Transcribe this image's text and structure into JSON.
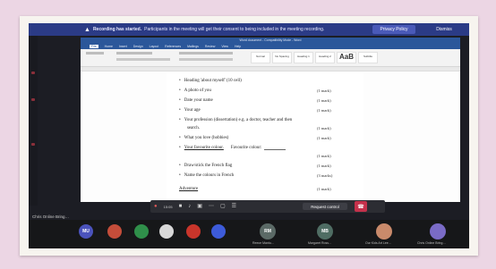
{
  "banner": {
    "bold": "Recording has started.",
    "message": "Participants in the meeting will get their consent to being included in the meeting recording.",
    "privacy_button": "Privacy Policy",
    "dismiss_button": "Dismiss"
  },
  "word": {
    "title": "Word document - Compatibility Mode - Word",
    "tabs": [
      "File",
      "Home",
      "Insert",
      "Design",
      "Layout",
      "References",
      "Mailings",
      "Review",
      "View",
      "Help"
    ],
    "styles": [
      "Normal",
      "No Spacing",
      "Heading 1",
      "Heading 2",
      "Title",
      "Subtitle"
    ],
    "title_style_sample": "AaB"
  },
  "document": {
    "items": [
      {
        "text": "Heading 'about myself' (10 cell)",
        "mark": ""
      },
      {
        "text": "A photo of you",
        "mark": "(1 mark)"
      },
      {
        "text": "Date your name",
        "mark": "(1 mark)"
      },
      {
        "text": "Your age",
        "mark": "(1 mark)"
      },
      {
        "text": "Your profession (dissertation) e.g. a doctor, teacher and then",
        "mark": ""
      },
      {
        "text": "search.",
        "mark": "(1 mark)"
      },
      {
        "text": "What you love (hobbies)",
        "mark": "(1 mark)"
      },
      {
        "text": "Your favourite colour.",
        "extra": "Favourite colour:",
        "mark": ""
      },
      {
        "text": "",
        "mark": "(1 mark)"
      },
      {
        "text": "Draw/stick the French flag",
        "mark": "(1 mark)"
      },
      {
        "text": "Name the colours in French",
        "mark": "(3 marks)"
      }
    ],
    "footer_word": "Adventure",
    "footer_mark": "(1 mark)"
  },
  "controls": {
    "timer": "15:05",
    "request_control": "Request control"
  },
  "presenter": "Chris Online Bring…",
  "participants": [
    {
      "initials": "MU",
      "label": "",
      "color": "#4b53bc"
    },
    {
      "initials": "",
      "label": "",
      "color": "#c44d3a"
    },
    {
      "initials": "",
      "label": "",
      "color": "#2f8f4a"
    },
    {
      "initials": "",
      "label": "",
      "color": "#d8d8d8"
    },
    {
      "initials": "",
      "label": "",
      "color": "#c9352b"
    },
    {
      "initials": "",
      "label": "",
      "color": "#3d5bd9"
    },
    {
      "initials": "RM",
      "label": "Reece Mantu…",
      "color": "#5b6a66"
    },
    {
      "initials": "MB",
      "label": "Margaret Ross…",
      "color": "#4f6d63"
    },
    {
      "initials": "",
      "label": "Our Kids Art Lee…",
      "color": "#c98a6b"
    },
    {
      "initials": "",
      "label": "Chris Online Bring…",
      "color": "#7a6bc6"
    }
  ]
}
